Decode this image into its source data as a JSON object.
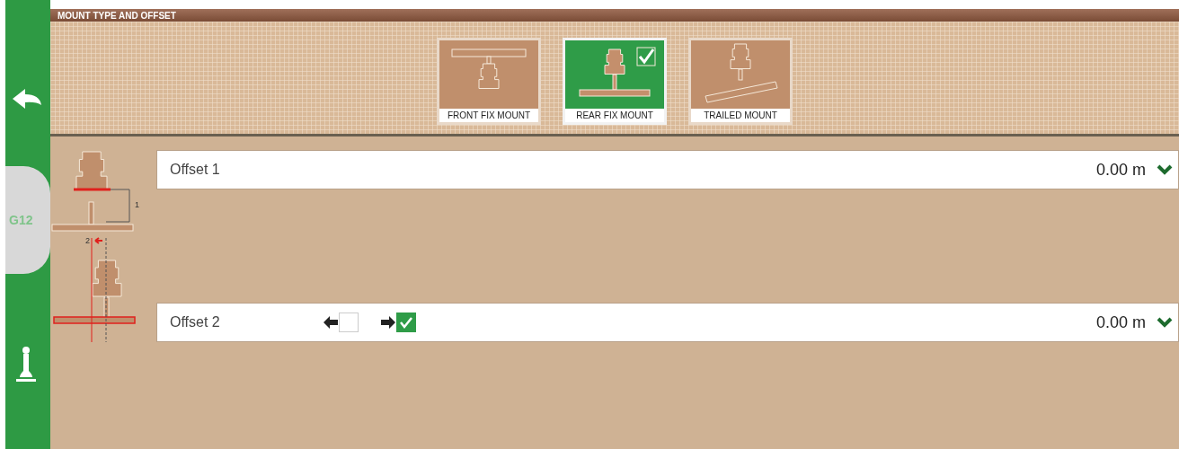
{
  "sidebar": {
    "logo": "G12"
  },
  "header": {
    "title": "MOUNT TYPE AND OFFSET"
  },
  "mounts": [
    {
      "kind": "front",
      "label": "FRONT FIX MOUNT",
      "selected": false
    },
    {
      "kind": "rear",
      "label": "REAR FIX MOUNT",
      "selected": true
    },
    {
      "kind": "trailed",
      "label": "TRAILED MOUNT",
      "selected": false
    }
  ],
  "offsets": [
    {
      "kind": "longitudinal",
      "label": "Offset 1",
      "value": "0.00 m",
      "diagram_label": "1"
    },
    {
      "kind": "lateral",
      "label": "Offset 2",
      "value": "0.00 m",
      "diagram_label": "2",
      "directions": [
        {
          "kind": "left",
          "checked": false
        },
        {
          "kind": "right",
          "checked": true
        }
      ]
    }
  ]
}
